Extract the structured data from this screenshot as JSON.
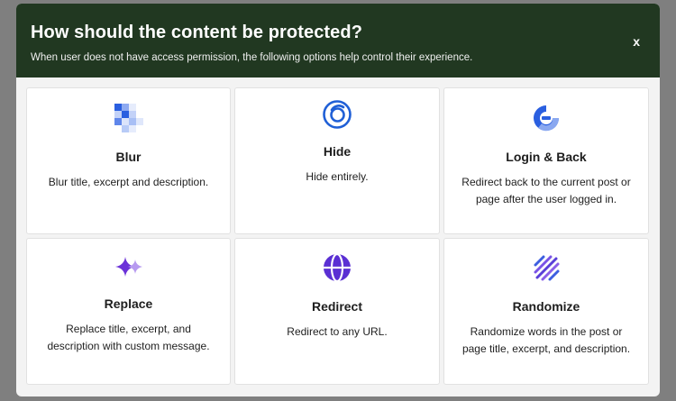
{
  "modal": {
    "title": "How should the content be protected?",
    "subtitle": "When user does not have access permission, the following options help control their experience.",
    "close_label": "x"
  },
  "options": [
    {
      "label": "Blur",
      "description": "Blur title, excerpt and description.",
      "icon": "blur-icon"
    },
    {
      "label": "Hide",
      "description": "Hide entirely.",
      "icon": "hide-icon"
    },
    {
      "label": "Login & Back",
      "description": "Redirect back to the current post or page after the user logged in.",
      "icon": "login-back-icon"
    },
    {
      "label": "Replace",
      "description": "Replace title, excerpt, and description with custom message.",
      "icon": "sparkle-icon"
    },
    {
      "label": "Redirect",
      "description": "Redirect to any URL.",
      "icon": "globe-icon"
    },
    {
      "label": "Randomize",
      "description": "Randomize words in the post or page title, excerpt, and description.",
      "icon": "randomize-icon"
    }
  ],
  "colors": {
    "header_bg": "#213821",
    "blue": "#1f5fd6",
    "purple": "#6b32d8",
    "violet": "#8d4ee6"
  }
}
